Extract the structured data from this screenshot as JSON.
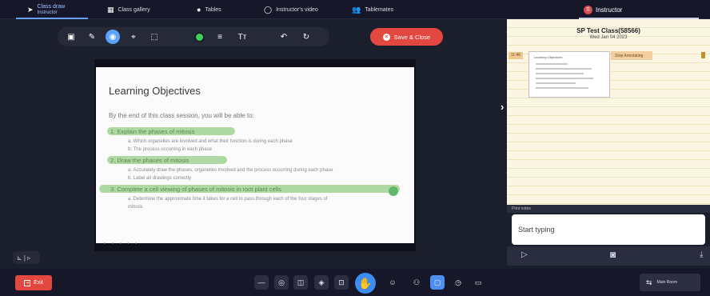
{
  "tabs": [
    {
      "label": "Class draw",
      "sub": "Instructor",
      "icon": "➤"
    },
    {
      "label": "Class gallery",
      "icon": "▦"
    },
    {
      "label": "Tables",
      "icon": "●"
    },
    {
      "label": "Instructor's video",
      "icon": "◯"
    },
    {
      "label": "Tablemates",
      "icon": "👥"
    }
  ],
  "instructor_tab": {
    "label": "Instructor",
    "avatar": "S"
  },
  "toolbar": {
    "tools": [
      "▣",
      "✎",
      "◉",
      "⌖",
      "⬚",
      "",
      "≡",
      "Tт",
      "↶",
      "↻"
    ],
    "save_label": "Save & Close",
    "close_glyph": "×"
  },
  "slide": {
    "title": "Learning Objectives",
    "intro": "By the end of this class session, you will be able to:",
    "objectives": [
      {
        "text": "1.   Explain the phases of mitosis",
        "subs": [
          "a.    Which organelles are involved and what their function is during each phase",
          "b.    The process occurring in each phase"
        ]
      },
      {
        "text": "2.   Draw the phases of mitosis",
        "subs": [
          "a.    Accurately draw the phases, organelles involved and the process occurring during each phase",
          "b.    Label all drawings correctly"
        ]
      },
      {
        "text": "3.   Complete a cell viewing of phases of mitosis in root plant cells",
        "subs": [
          "a.    Determine the approximate time it takes for a cell to pass through each of the four stages of",
          "       mitosis"
        ]
      }
    ],
    "page_dots": "• • • • •"
  },
  "side_arrow": "›",
  "left_ctrl": "⊾ | ▹",
  "notebook": {
    "title": "SP Test Class(58566)",
    "date": "Wed Jan 04 2023",
    "timestamp": "11:46",
    "tag": "Stop Annotating",
    "thumb_title": "Learning Objectives"
  },
  "notes": {
    "header": "Print notes",
    "placeholder": "Start typing",
    "send_glyph": "▷",
    "camera_glyph": "◙",
    "download_glyph": "⤓"
  },
  "bottom": {
    "exit_label": "Exit",
    "exit_glyph": "⇥",
    "buttons": [
      "—",
      "◎",
      "◫",
      "◈",
      "⊡",
      "✋",
      "☺",
      "⚇",
      "▢",
      "◷",
      "▭"
    ],
    "room_label": "Main Room",
    "room_glyph": "⇆"
  }
}
